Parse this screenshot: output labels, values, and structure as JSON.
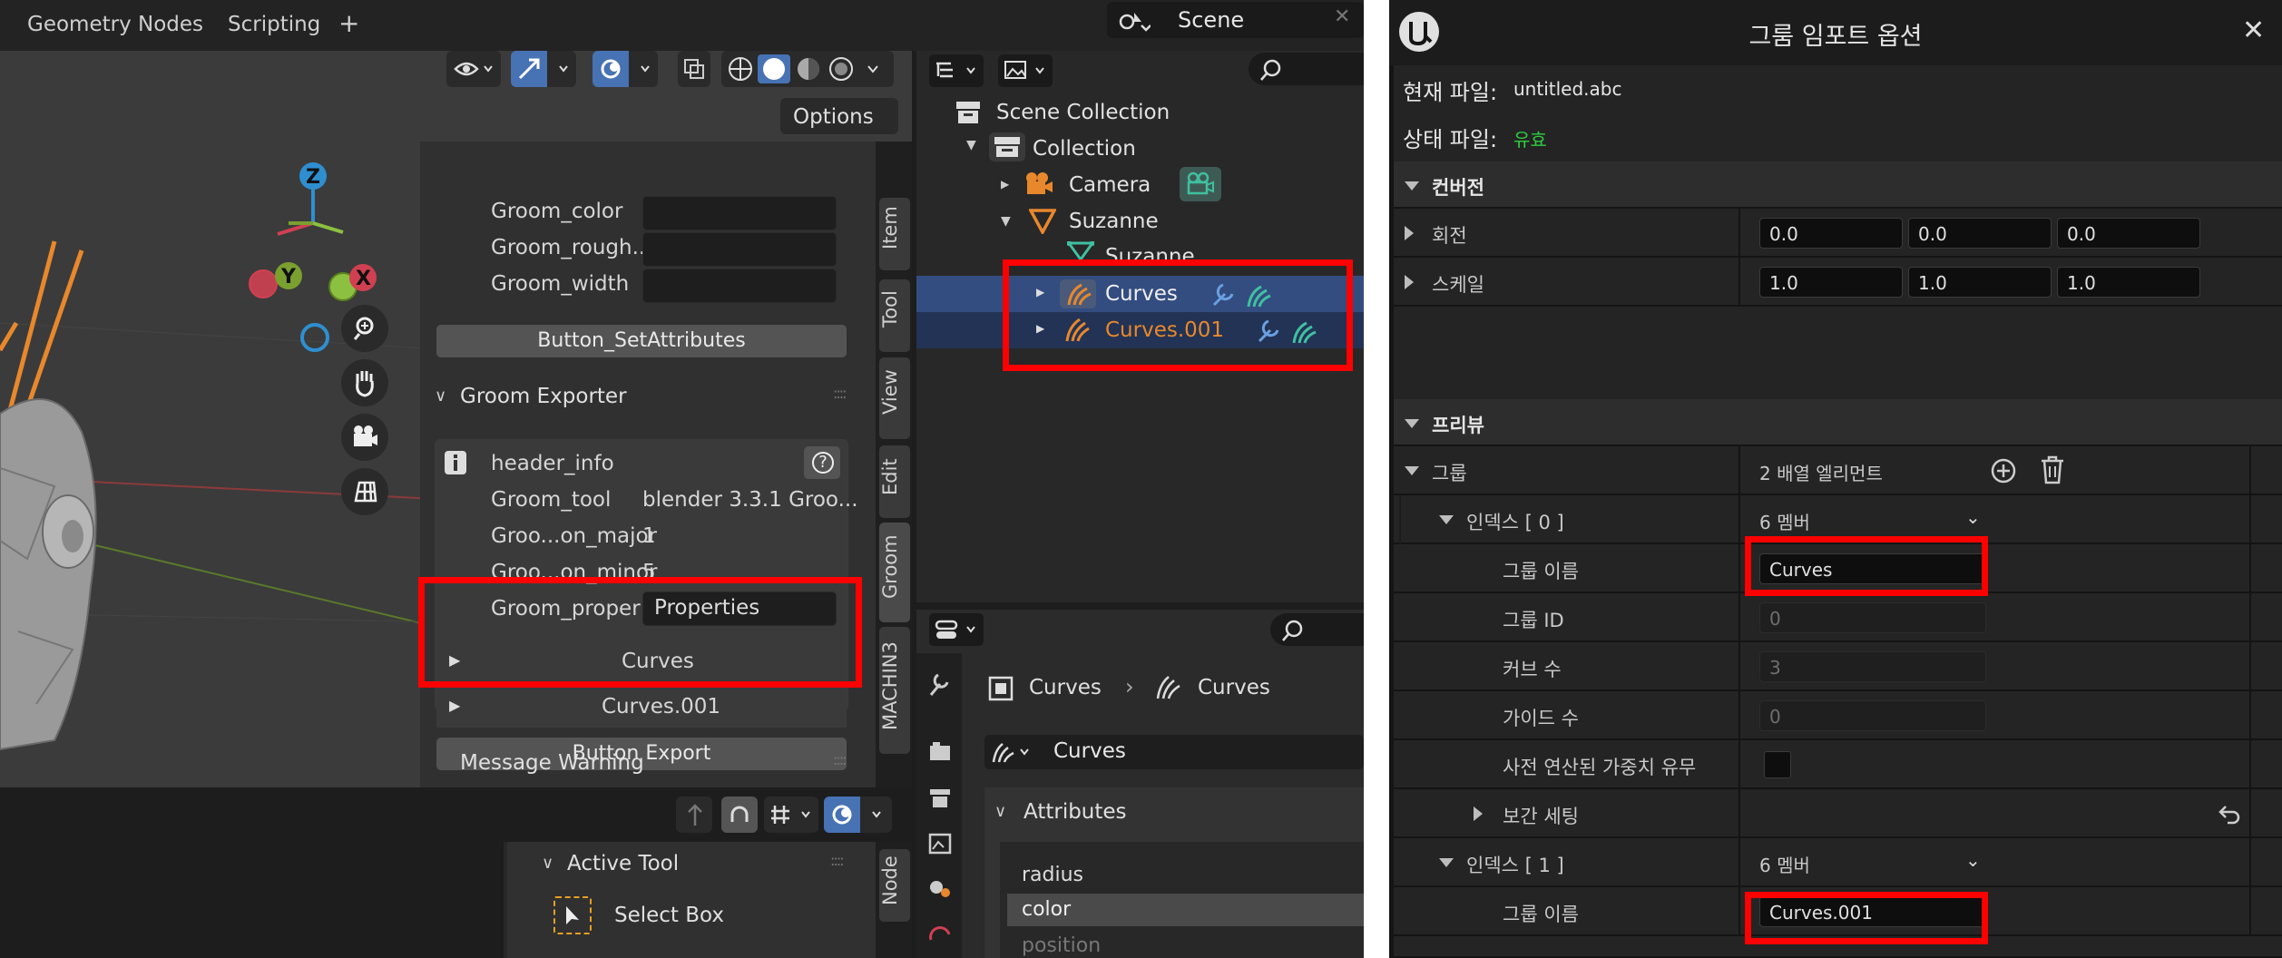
{
  "blender": {
    "workspace_tabs": [
      "Geometry Nodes",
      "Scripting"
    ],
    "add_workspace": "+",
    "scene_name": "Scene",
    "options_label": "Options",
    "npanel": {
      "groom_attrs": [
        "Groom_color",
        "Groom_rough...",
        "Groom_width"
      ],
      "set_attributes_button": "Button_SetAttributes",
      "exporter_title": "Groom Exporter",
      "header_info": "header_info",
      "help": "?",
      "info_rows": [
        {
          "label": "Groom_tool",
          "value": "blender 3.3.1 Groo..."
        },
        {
          "label": "Groo...on_major",
          "value": "1"
        },
        {
          "label": "Groo...on_minor",
          "value": "5"
        }
      ],
      "groom_proper_label": "Groom_proper",
      "groom_proper_value": "Properties",
      "curves_items": [
        "Curves",
        "Curves.001"
      ],
      "export_button": "Button Export",
      "message_warning": "Message Warning"
    },
    "vtabs": [
      "Item",
      "Tool",
      "View",
      "Edit",
      "Groom",
      "MACHIN3"
    ],
    "outliner": {
      "scene_collection": "Scene Collection",
      "collection": "Collection",
      "camera": "Camera",
      "suzanne": "Suzanne",
      "suzanne_mesh": "Suzanne",
      "curves": "Curves",
      "curves001": "Curves.001"
    },
    "properties": {
      "breadcrumb_obj": "Curves",
      "breadcrumb_data": "Curves",
      "datablock": "Curves",
      "attributes_title": "Attributes",
      "attributes": [
        "radius",
        "color",
        "position"
      ]
    },
    "node_editor": {
      "active_tool_title": "Active Tool",
      "select_box": "Select Box",
      "node_tab": "Node"
    },
    "gizmo": {
      "z": "Z",
      "y": "Y",
      "x": "X"
    }
  },
  "unreal": {
    "title": "그룸 임포트 옵션",
    "current_file_label": "현재 파일:",
    "current_file_value": "untitled.abc",
    "status_file_label": "상태 파일:",
    "status_file_value": "유효",
    "conversion_section": "컨버전",
    "rotation_label": "회전",
    "rotation_values": [
      "0.0",
      "0.0",
      "0.0"
    ],
    "scale_label": "스케일",
    "scale_values": [
      "1.0",
      "1.0",
      "1.0"
    ],
    "preview_section": "프리뷰",
    "groom_label": "그룹",
    "groom_elements": "2 배열 엘리먼트",
    "index0_label": "인덱스 [ 0 ]",
    "index0_members": "6 멤버",
    "group_name_label": "그룹 이름",
    "group_name0": "Curves",
    "group_id_label": "그룹 ID",
    "group_id_value": "0",
    "curve_count_label": "커브 수",
    "curve_count_value": "3",
    "guide_count_label": "가이드 수",
    "guide_count_value": "0",
    "precomputed_weights_label": "사전 연산된 가중치 유무",
    "interp_settings_label": "보간 세팅",
    "index1_label": "인덱스 [ 1 ]",
    "index1_members": "6 멤버",
    "group_name1": "Curves.001",
    "colors": {
      "status_ok": "#2ecc40",
      "highlight": "#ff0000",
      "curves_orange": "#e8882c",
      "selection": "#334d80"
    }
  }
}
